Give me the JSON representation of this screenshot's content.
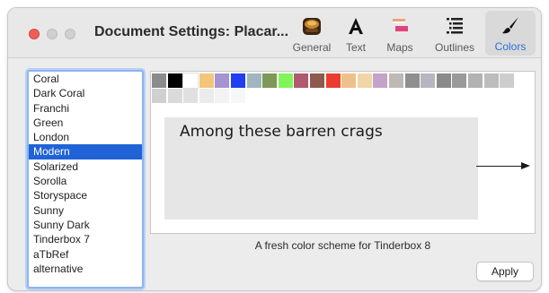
{
  "window": {
    "title": "Document Settings: Placar..."
  },
  "toolbar": {
    "items": [
      {
        "label": "General",
        "icon": "general-icon"
      },
      {
        "label": "Text",
        "icon": "text-icon"
      },
      {
        "label": "Maps",
        "icon": "maps-icon"
      },
      {
        "label": "Outlines",
        "icon": "outlines-icon"
      },
      {
        "label": "Colors",
        "icon": "colors-icon",
        "selected": true
      }
    ],
    "accent_color": "#2a72d8"
  },
  "schemes": {
    "items": [
      "Coral",
      "Dark Coral",
      "Franchi",
      "Green",
      "London",
      "Modern",
      "Solarized",
      "Sorolla",
      "Storyspace",
      "Sunny",
      "Sunny Dark",
      "Tinderbox 7",
      "aTbRef",
      "alternative"
    ],
    "selected": "Modern",
    "selection_color": "#1f63d6"
  },
  "preview": {
    "swatches_row1": [
      "#8c8c8c",
      "#000000",
      "#ffffff",
      "#f3c57b",
      "#a593d3",
      "#1f3ff2",
      "#9fb6c0",
      "#7e9858",
      "#7ff55a",
      "#b0596f",
      "#8e5a4d",
      "#ea3d2f",
      "#f0c08a",
      "#f1d5a5",
      "#c3a3c9",
      "#c0b8b5",
      "#8f8f8f",
      "#b6b5c0",
      "#8a8a8a",
      "#9a9a9a",
      "#b2b2b2",
      "#bcbcbc",
      "#cdcdcd"
    ],
    "swatches_row2": [
      "#d0d0d0",
      "#dadada",
      "#e0e0e0",
      "#ebebeb",
      "#f2f2f2",
      "#f7f7f7"
    ],
    "note_title": "Among these barren crags"
  },
  "description": "A fresh color scheme for Tinderbox 8",
  "apply_label": "Apply"
}
